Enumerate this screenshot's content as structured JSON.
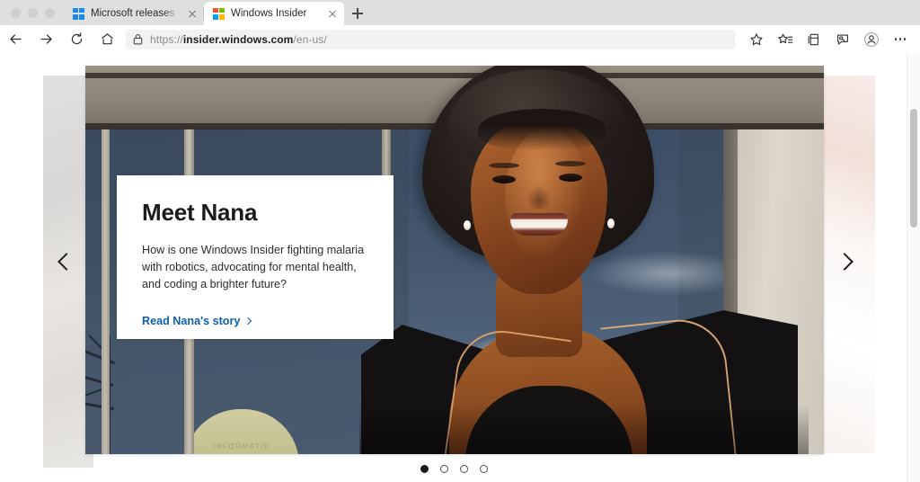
{
  "window": {
    "traffic_lights": [
      "close",
      "minimize",
      "maximize"
    ]
  },
  "tabs": [
    {
      "title": "Microsoft releases new Windo",
      "favicon": "windows-logo-blue-icon",
      "active": false,
      "close_label": "Close tab",
      "favicon_colors": [
        "#1b8ae8",
        "#1b8ae8",
        "#1b8ae8",
        "#1b8ae8"
      ]
    },
    {
      "title": "Windows Insider",
      "favicon": "microsoft-logo-icon",
      "active": true,
      "close_label": "Close tab",
      "favicon_colors": [
        "#f25022",
        "#7fba00",
        "#00a4ef",
        "#ffb900"
      ]
    }
  ],
  "new_tab": {
    "label": "+",
    "tooltip": "New tab"
  },
  "toolbar": {
    "back": "Back",
    "forward": "Forward",
    "refresh": "Refresh",
    "home": "Home",
    "lock": "Connection is secure",
    "url_scheme": "https://",
    "url_domain": "insider.windows.com",
    "url_path": "/en-us/",
    "actions": [
      {
        "name": "favorite-star-icon",
        "label": "Add this page to favorites"
      },
      {
        "name": "favorites-list-icon",
        "label": "Favorites"
      },
      {
        "name": "collections-icon",
        "label": "Collections"
      },
      {
        "name": "share-icon",
        "label": "Share"
      },
      {
        "name": "profile-icon",
        "label": "Profile"
      },
      {
        "name": "settings-more-icon",
        "label": "Settings and more"
      }
    ]
  },
  "page": {
    "carousel": {
      "prev_label": "Previous slide",
      "next_label": "Next slide",
      "dots": [
        {
          "index": 1,
          "active": true
        },
        {
          "index": 2,
          "active": false
        },
        {
          "index": 3,
          "active": false
        },
        {
          "index": 4,
          "active": false
        }
      ],
      "slide": {
        "heading": "Meet Nana",
        "body": "How is one Windows Insider fighting malaria with robotics, advocating for mental health, and coding a brighter future?",
        "link": "Read Nana's story",
        "image_alt": "Smiling woman with natural afro hair wearing a black blazer with gold piping, standing in front of a building with large blue-tinted windows",
        "dome_text": "INFORMATIK"
      }
    }
  },
  "scrollbar": {
    "position": "top"
  },
  "colors": {
    "link": "#0f5fa8",
    "tabstrip_bg": "#dfdfdf",
    "active_tab_bg": "#ffffff",
    "omnibox_bg": "#f2f2f2",
    "card_bg": "#ffffff",
    "page_bg": "#ffffff"
  }
}
